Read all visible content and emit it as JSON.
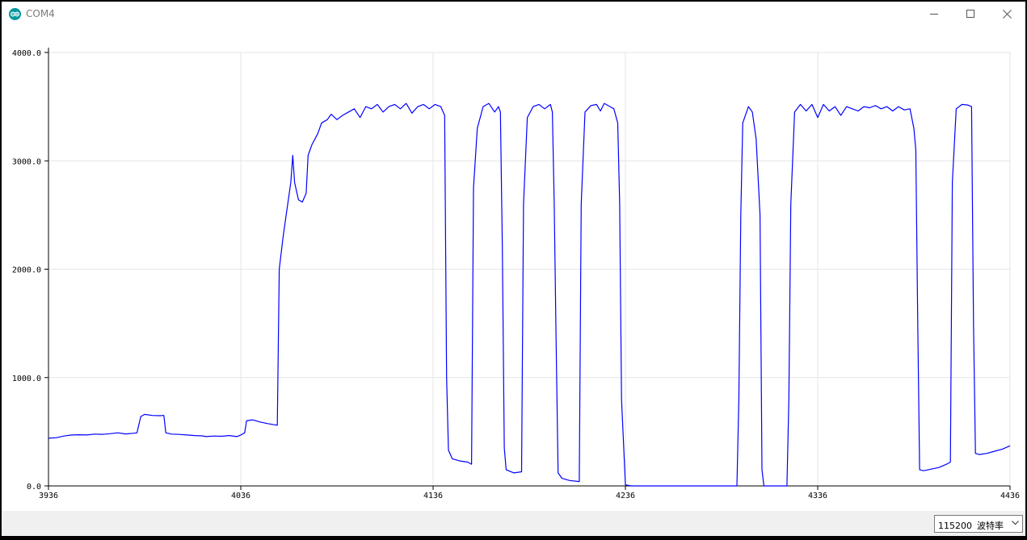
{
  "window": {
    "title": "COM4",
    "app_icon": "arduino-logo-icon",
    "controls": {
      "minimize_icon": "minimize-icon",
      "maximize_icon": "maximize-icon",
      "close_icon": "close-icon"
    }
  },
  "footer": {
    "baud_rate": "115200",
    "baud_unit": "波特率",
    "dropdown_icon": "chevron-down-icon"
  },
  "colors": {
    "series": "#0000ff",
    "grid": "#e6e6e6",
    "footer_bg": "#f0f0f0"
  },
  "chart_data": {
    "type": "line",
    "title": "",
    "xlabel": "",
    "ylabel": "",
    "xlim": [
      3936,
      4436
    ],
    "ylim": [
      0,
      4000
    ],
    "x_ticks": [
      3936,
      4036,
      4136,
      4236,
      4336,
      4436
    ],
    "y_ticks": [
      {
        "value": 0,
        "label": "0.0"
      },
      {
        "value": 1000,
        "label": "1000.0"
      },
      {
        "value": 2000,
        "label": "2000.0"
      },
      {
        "value": 3000,
        "label": "3000.0"
      },
      {
        "value": 4000,
        "label": "4000.0"
      }
    ],
    "grid": true,
    "series": [
      {
        "color": "#0000ff",
        "points": [
          [
            3936,
            440
          ],
          [
            3940,
            445
          ],
          [
            3944,
            460
          ],
          [
            3948,
            470
          ],
          [
            3952,
            472
          ],
          [
            3956,
            470
          ],
          [
            3960,
            478
          ],
          [
            3964,
            476
          ],
          [
            3968,
            482
          ],
          [
            3972,
            490
          ],
          [
            3976,
            480
          ],
          [
            3980,
            486
          ],
          [
            3982,
            490
          ],
          [
            3984,
            640
          ],
          [
            3986,
            660
          ],
          [
            3990,
            650
          ],
          [
            3994,
            648
          ],
          [
            3996,
            650
          ],
          [
            3997,
            490
          ],
          [
            4000,
            478
          ],
          [
            4004,
            475
          ],
          [
            4008,
            470
          ],
          [
            4012,
            465
          ],
          [
            4016,
            462
          ],
          [
            4018,
            455
          ],
          [
            4022,
            460
          ],
          [
            4026,
            458
          ],
          [
            4030,
            465
          ],
          [
            4034,
            455
          ],
          [
            4036,
            470
          ],
          [
            4038,
            490
          ],
          [
            4039,
            600
          ],
          [
            4042,
            610
          ],
          [
            4046,
            590
          ],
          [
            4050,
            575
          ],
          [
            4055,
            560
          ],
          [
            4056,
            2000
          ],
          [
            4058,
            2300
          ],
          [
            4060,
            2550
          ],
          [
            4062,
            2800
          ],
          [
            4063,
            3050
          ],
          [
            4064,
            2800
          ],
          [
            4066,
            2640
          ],
          [
            4068,
            2620
          ],
          [
            4070,
            2700
          ],
          [
            4071,
            3050
          ],
          [
            4073,
            3150
          ],
          [
            4076,
            3250
          ],
          [
            4078,
            3350
          ],
          [
            4081,
            3380
          ],
          [
            4083,
            3430
          ],
          [
            4086,
            3380
          ],
          [
            4089,
            3420
          ],
          [
            4092,
            3450
          ],
          [
            4095,
            3480
          ],
          [
            4098,
            3400
          ],
          [
            4101,
            3500
          ],
          [
            4104,
            3480
          ],
          [
            4107,
            3520
          ],
          [
            4110,
            3450
          ],
          [
            4113,
            3500
          ],
          [
            4116,
            3520
          ],
          [
            4119,
            3480
          ],
          [
            4122,
            3530
          ],
          [
            4125,
            3440
          ],
          [
            4128,
            3500
          ],
          [
            4131,
            3520
          ],
          [
            4134,
            3480
          ],
          [
            4137,
            3520
          ],
          [
            4140,
            3500
          ],
          [
            4142,
            3420
          ],
          [
            4143,
            1000
          ],
          [
            4144,
            330
          ],
          [
            4146,
            250
          ],
          [
            4150,
            230
          ],
          [
            4154,
            220
          ],
          [
            4156,
            200
          ],
          [
            4157,
            2750
          ],
          [
            4159,
            3300
          ],
          [
            4162,
            3500
          ],
          [
            4165,
            3530
          ],
          [
            4168,
            3450
          ],
          [
            4170,
            3500
          ],
          [
            4171,
            3450
          ],
          [
            4172,
            2200
          ],
          [
            4173,
            350
          ],
          [
            4174,
            150
          ],
          [
            4178,
            120
          ],
          [
            4182,
            130
          ],
          [
            4183,
            2600
          ],
          [
            4185,
            3400
          ],
          [
            4188,
            3500
          ],
          [
            4191,
            3520
          ],
          [
            4194,
            3480
          ],
          [
            4197,
            3520
          ],
          [
            4198,
            3450
          ],
          [
            4199,
            2600
          ],
          [
            4200,
            1300
          ],
          [
            4201,
            120
          ],
          [
            4203,
            70
          ],
          [
            4207,
            50
          ],
          [
            4212,
            40
          ],
          [
            4213,
            2600
          ],
          [
            4215,
            3450
          ],
          [
            4218,
            3510
          ],
          [
            4221,
            3520
          ],
          [
            4223,
            3460
          ],
          [
            4225,
            3530
          ],
          [
            4228,
            3500
          ],
          [
            4230,
            3480
          ],
          [
            4232,
            3350
          ],
          [
            4233,
            2600
          ],
          [
            4234,
            800
          ],
          [
            4236,
            10
          ],
          [
            4239,
            0
          ],
          [
            4290,
            0
          ],
          [
            4294,
            0
          ],
          [
            4295,
            800
          ],
          [
            4296,
            2500
          ],
          [
            4297,
            3350
          ],
          [
            4300,
            3500
          ],
          [
            4302,
            3450
          ],
          [
            4304,
            3200
          ],
          [
            4306,
            2500
          ],
          [
            4307,
            150
          ],
          [
            4308,
            0
          ],
          [
            4310,
            0
          ],
          [
            4318,
            0
          ],
          [
            4320,
            0
          ],
          [
            4321,
            800
          ],
          [
            4322,
            2600
          ],
          [
            4324,
            3450
          ],
          [
            4327,
            3520
          ],
          [
            4330,
            3460
          ],
          [
            4333,
            3520
          ],
          [
            4336,
            3400
          ],
          [
            4339,
            3520
          ],
          [
            4342,
            3460
          ],
          [
            4345,
            3500
          ],
          [
            4348,
            3420
          ],
          [
            4351,
            3500
          ],
          [
            4354,
            3480
          ],
          [
            4357,
            3460
          ],
          [
            4360,
            3500
          ],
          [
            4363,
            3490
          ],
          [
            4366,
            3510
          ],
          [
            4369,
            3480
          ],
          [
            4372,
            3500
          ],
          [
            4375,
            3460
          ],
          [
            4378,
            3500
          ],
          [
            4381,
            3470
          ],
          [
            4384,
            3480
          ],
          [
            4386,
            3300
          ],
          [
            4387,
            3100
          ],
          [
            4388,
            1500
          ],
          [
            4389,
            150
          ],
          [
            4391,
            140
          ],
          [
            4395,
            155
          ],
          [
            4399,
            170
          ],
          [
            4403,
            200
          ],
          [
            4405,
            220
          ],
          [
            4406,
            2800
          ],
          [
            4408,
            3480
          ],
          [
            4411,
            3520
          ],
          [
            4414,
            3515
          ],
          [
            4416,
            3500
          ],
          [
            4417,
            1500
          ],
          [
            4418,
            300
          ],
          [
            4420,
            290
          ],
          [
            4424,
            300
          ],
          [
            4428,
            320
          ],
          [
            4432,
            340
          ],
          [
            4436,
            370
          ]
        ]
      }
    ]
  }
}
